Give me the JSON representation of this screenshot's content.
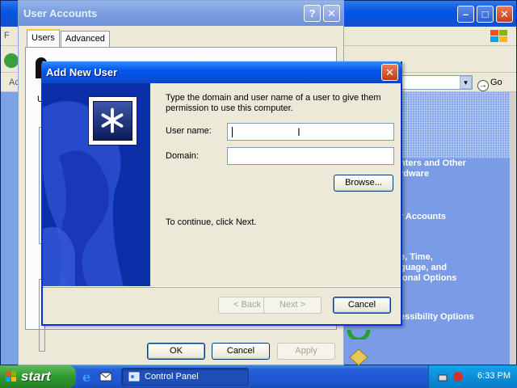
{
  "control_panel": {
    "menu_first_letter": "F",
    "address_first_letters": "Ac",
    "go_label": "Go",
    "categories": [
      "Printers and Other\nHardware",
      "User Accounts",
      "Date, Time,\nLanguage, and\nRegional Options",
      "Accessibility Options"
    ],
    "categories_visible": [
      "nters and Other\nrdware",
      "r Accounts",
      "e, Time,\nguage, and\nional Options",
      "essibility Options"
    ]
  },
  "user_accounts": {
    "title": "User Accounts",
    "tabs": [
      {
        "label": "Users",
        "active": true
      },
      {
        "label": "Advanced",
        "active": false
      }
    ],
    "side_letter": "U",
    "buttons": {
      "ok": "OK",
      "cancel": "Cancel",
      "apply": "Apply"
    }
  },
  "add_new_user": {
    "title": "Add New User",
    "instructions": "Type the domain and user name of a user to give them permission to use this computer.",
    "username_label": "User name:",
    "username_value": "",
    "domain_label": "Domain:",
    "domain_value": "",
    "browse_label": "Browse...",
    "continue_text": "To continue, click Next.",
    "back_label": "< Back",
    "next_label": "Next >",
    "cancel_label": "Cancel"
  },
  "taskbar": {
    "start_label": "start",
    "task_label": "Control Panel",
    "clock": "6:33 PM"
  },
  "colors": {
    "xp_blue": "#0054e3",
    "start_green": "#2f9a2f",
    "dialog_sidebar": "#0a2fa8"
  }
}
